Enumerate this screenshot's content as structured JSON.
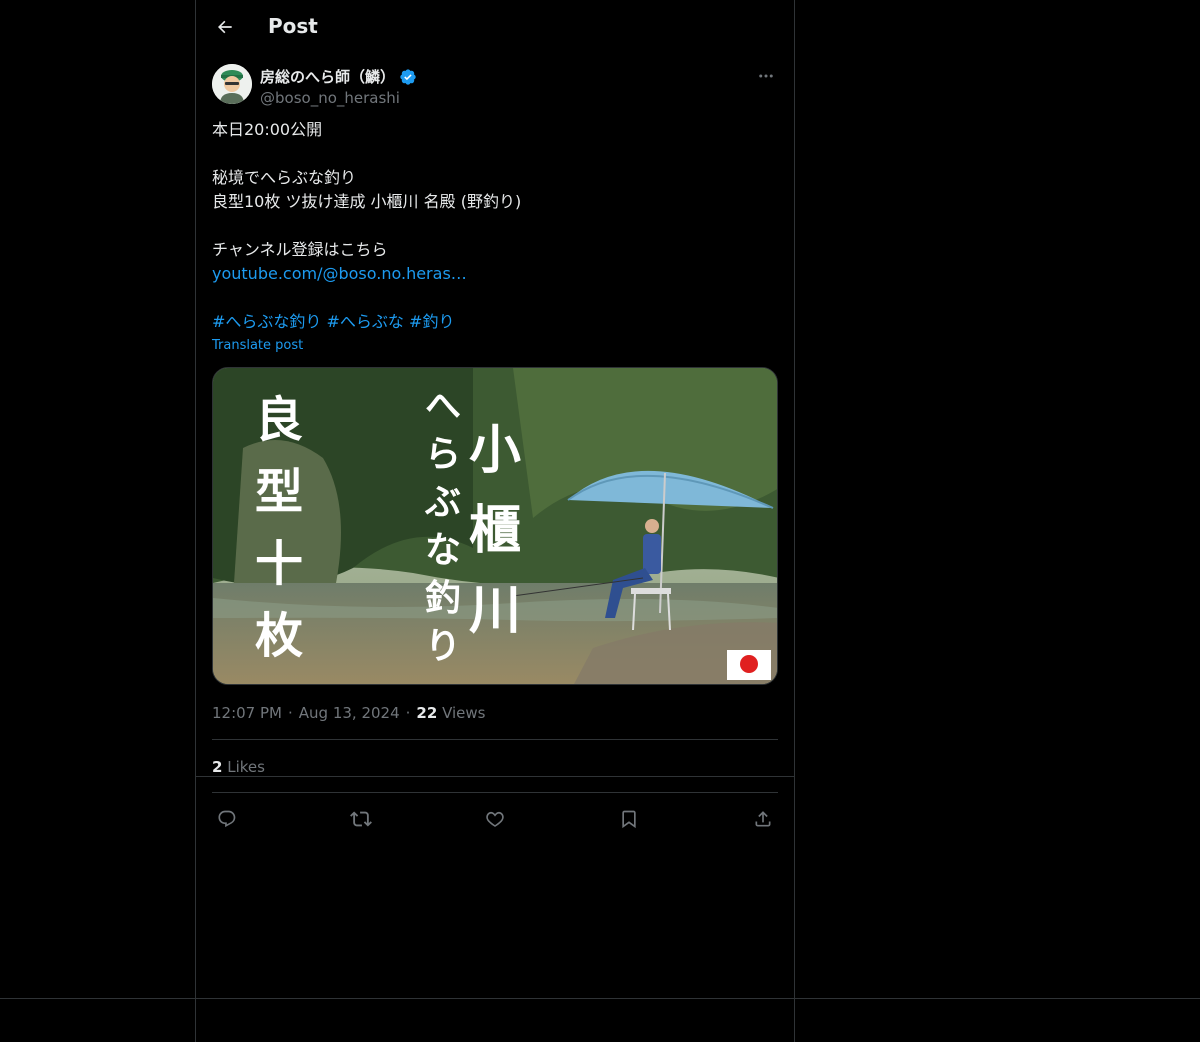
{
  "header": {
    "title": "Post"
  },
  "author": {
    "display_name": "房総のへら師（鱗）",
    "handle": "@boso_no_herashi",
    "verified": true
  },
  "post": {
    "lines": [
      "本日20:00公開",
      "",
      "秘境でへらぶな釣り",
      "良型10枚 ツ抜け達成 小櫃川 名殿 (野釣り)",
      "",
      "チャンネル登録はこちら"
    ],
    "link": "youtube.com/@boso.no.heras…",
    "hashtags": [
      "#へらぶな釣り",
      "#へらぶな",
      "#釣り"
    ],
    "translate_label": "Translate post"
  },
  "media": {
    "left_text": [
      "良",
      "型",
      "十",
      "枚"
    ],
    "middle_text": [
      "へ",
      "ら",
      "ぶ",
      "な",
      "釣",
      "り"
    ],
    "right_text": [
      "小",
      "櫃",
      "川"
    ]
  },
  "meta": {
    "time": "12:07 PM",
    "date": "Aug 13, 2024",
    "views_count": "22",
    "views_label": "Views",
    "separator": "·"
  },
  "likes": {
    "count": "2",
    "label": "Likes"
  },
  "colors": {
    "background": "#000000",
    "text": "#e7e9ea",
    "secondary": "#71767b",
    "link": "#1d9bf0",
    "border": "#2f3336",
    "verified": "#1d9bf0"
  },
  "icons": [
    "back-arrow-icon",
    "verified-badge-icon",
    "more-icon",
    "reply-icon",
    "repost-icon",
    "like-icon",
    "bookmark-icon",
    "share-icon"
  ]
}
